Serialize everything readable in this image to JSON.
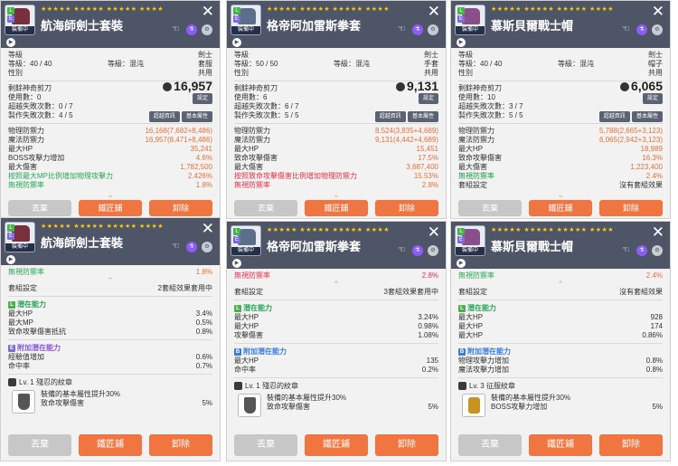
{
  "colors": {
    "header": "#4d5566",
    "orange": "#e8703a",
    "green": "#2aa55a",
    "red": "#e0334a",
    "star": "#f5c518"
  },
  "stars": "★★★★★ ★★★★★ ★★★★★ ★★★★",
  "close_glyph": "✕",
  "equipped": "裝備中",
  "badge_l": "L",
  "badge_e": "E",
  "labels": {
    "level": "等級",
    "level_sep": "等級：",
    "chaos": "混沌",
    "gender": "性別",
    "scissors": "剩餘神奇剪刀",
    "uses": "使用數：",
    "upgrades": "超越失敗次數：",
    "crafts": "製作失敗次數：",
    "set_label": "設定",
    "super_info": "超越資訊",
    "basic_attr": "基本屬性",
    "phys_def": "物理防禦力",
    "mag_def": "魔法防禦力",
    "max_hp": "最大HP",
    "boss": "BOSS攻擊力增加",
    "crit_dmg": "致命攻擊傷害",
    "max_dmg": "最大傷害",
    "ignore_def": "無視防禦率",
    "set_effect": "套組設定",
    "potential": "潛在能力",
    "add_potential": "附加潛在能力",
    "max_mp": "最大MP",
    "crit_res": "致命攻擊傷害抵抗",
    "exp_add": "經驗值增加",
    "accuracy": "命中率",
    "phys_atk": "物理攻擊力增加",
    "mag_atk": "魔法攻擊力增加",
    "btn_drop": "丟棄",
    "btn_smith": "鐵匠鋪",
    "btn_remove": "卸除"
  },
  "top": [
    {
      "name": "航海師劍士套裝",
      "job": "劍士",
      "type": "套服",
      "level_range": "40 / 40",
      "gender": "共用",
      "uses": "0",
      "upgrade_fail": "0 / 7",
      "craft_fail": "4 / 5",
      "scissors_val": "16,957",
      "rows": [
        {
          "l": "物理防禦力",
          "v": "16,168(7,682+8,486)",
          "c": "orange"
        },
        {
          "l": "魔法防禦力",
          "v": "16,957(8,471+8,486)",
          "c": "orange"
        },
        {
          "l": "最大HP",
          "v": "35,241",
          "c": "orange"
        },
        {
          "l": "BOSS攻擊力增加",
          "v": "4.6%",
          "c": "orange"
        },
        {
          "l": "最大傷害",
          "v": "1,782,500",
          "c": "orange"
        },
        {
          "l": "按照最大MP比例增加物理攻擊力",
          "v": "2.426%",
          "c": "orange",
          "lc": "green"
        },
        {
          "l": "無視防禦率",
          "v": "1.8%",
          "c": "orange",
          "lc": "green"
        }
      ]
    },
    {
      "name": "格帝阿加雷斯拳套",
      "job": "劍士",
      "type": "手套",
      "level_range": "50 / 50",
      "gender": "共用",
      "uses": "6",
      "upgrade_fail": "6 / 7",
      "craft_fail": "5 / 5",
      "scissors_val": "9,131",
      "rows": [
        {
          "l": "物理防禦力",
          "v": "8,524(3,835+4,689)",
          "c": "orange"
        },
        {
          "l": "魔法防禦力",
          "v": "9,131(4,442+4,689)",
          "c": "orange"
        },
        {
          "l": "最大HP",
          "v": "15,451",
          "c": "orange"
        },
        {
          "l": "致命攻擊傷害",
          "v": "17.5%",
          "c": "orange"
        },
        {
          "l": "最大傷害",
          "v": "3,687,400",
          "c": "orange"
        },
        {
          "l": "按照致命攻擊傷害比例增加物理防禦力",
          "v": "15.53%",
          "c": "orange",
          "lc": "red"
        },
        {
          "l": "無視防禦率",
          "v": "2.8%",
          "c": "orange",
          "lc": "red"
        }
      ]
    },
    {
      "name": "慕斯貝爾戰士帽",
      "job": "劍士",
      "type": "帽子",
      "level_range": "40 / 40",
      "gender": "共用",
      "uses": "10",
      "upgrade_fail": "3 / 7",
      "craft_fail": "5 / 5",
      "scissors_val": "6,065",
      "rows": [
        {
          "l": "物理防禦力",
          "v": "5,788(2,665+3,123)",
          "c": "orange"
        },
        {
          "l": "魔法防禦力",
          "v": "6,065(2,942+3,123)",
          "c": "orange"
        },
        {
          "l": "最大HP",
          "v": "18,989",
          "c": "orange"
        },
        {
          "l": "致命攻擊傷害",
          "v": "16.3%",
          "c": "orange"
        },
        {
          "l": "最大傷害",
          "v": "1,223,400",
          "c": "orange"
        },
        {
          "l": "無視防禦率",
          "v": "2.4%",
          "c": "orange",
          "lc": "greenhl"
        },
        {
          "l": "套組設定",
          "v": "沒有套組效果",
          "c": ""
        }
      ]
    }
  ],
  "bottom": [
    {
      "name": "航海師劍士套裝",
      "ignore": "1.8%",
      "set": "2套組效果套用中",
      "pot": [
        {
          "l": "最大HP",
          "v": "3.4%"
        },
        {
          "l": "最大MP",
          "v": "0.5%"
        },
        {
          "l": "致命攻擊傷害抵抗",
          "v": "0.8%"
        }
      ],
      "add": [
        {
          "l": "經驗值增加",
          "v": "0.6%"
        },
        {
          "l": "命中率",
          "v": "0.7%"
        }
      ],
      "emblem": "Lv. 1 殘忍的紋章",
      "em1": "裝備的基本屬性提升30%",
      "em2": "致命攻擊傷害",
      "emv": "5%"
    },
    {
      "name": "格帝阿加雷斯拳套",
      "ignore": "2.8%",
      "set": "3套組效果套用中",
      "pot": [
        {
          "l": "最大HP",
          "v": "3.24%"
        },
        {
          "l": "最大HP",
          "v": "0.98%"
        },
        {
          "l": "攻擊傷害",
          "v": "1.08%"
        }
      ],
      "add": [
        {
          "l": "最大HP",
          "v": "135"
        },
        {
          "l": "命中率",
          "v": "0.2%"
        }
      ],
      "emblem": "Lv. 1 殘忍的紋章",
      "em1": "裝備的基本屬性提升30%",
      "em2": "致命攻擊傷害",
      "emv": "5%"
    },
    {
      "name": "慕斯貝爾戰士帽",
      "ignore": "2.4%",
      "set": "沒有套組效果",
      "pot": [
        {
          "l": "最大HP",
          "v": "928"
        },
        {
          "l": "最大HP",
          "v": "174"
        },
        {
          "l": "最大HP",
          "v": "0.86%"
        }
      ],
      "add": [
        {
          "l": "物理攻擊力增加",
          "v": "0.8%"
        },
        {
          "l": "魔法攻擊力增加",
          "v": "0.8%"
        }
      ],
      "emblem": "Lv. 3 征服紋章",
      "em1": "裝備的基本屬性提升30%",
      "em2": "BOSS攻擊力增加",
      "emv": "5%"
    }
  ]
}
